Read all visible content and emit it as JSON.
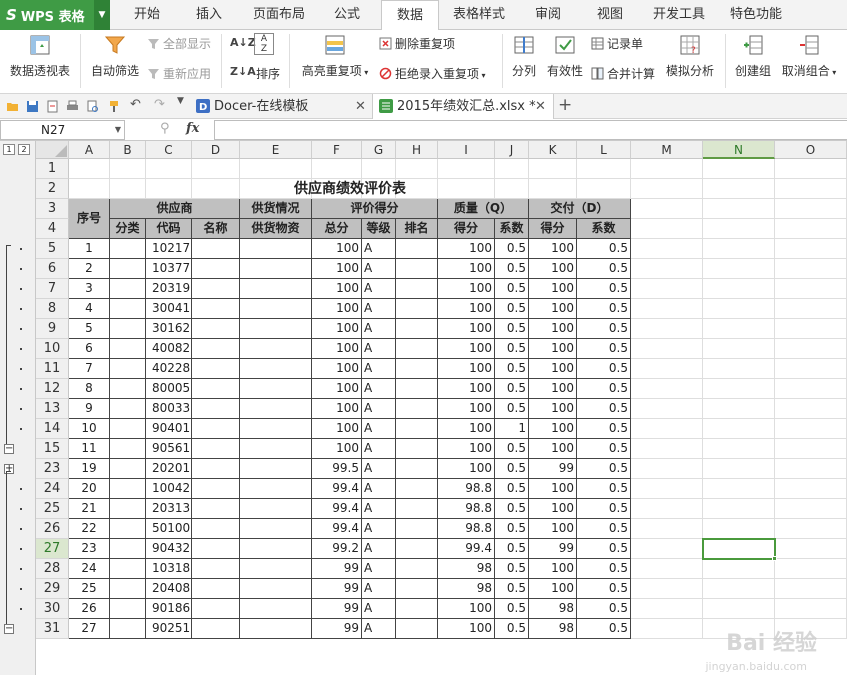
{
  "app": {
    "name": "WPS 表格",
    "logo": "S"
  },
  "menu_tabs": [
    "开始",
    "插入",
    "页面布局",
    "公式",
    "数据",
    "表格样式",
    "审阅",
    "视图",
    "开发工具",
    "特色功能"
  ],
  "menu_active_index": 4,
  "ribbon": {
    "pivot": "数据透视表",
    "autofilter": "自动筛选",
    "show_all": "全部显示",
    "reapply": "重新应用",
    "sort": "排序",
    "highlight_dup": "高亮重复项",
    "remove_dup": "删除重复项",
    "reject_dup": "拒绝录入重复项",
    "split": "分列",
    "validity": "有效性",
    "record_form": "记录单",
    "consolidate": "合并计算",
    "simulate": "模拟分析",
    "create_group": "创建组",
    "ungroup": "取消组合"
  },
  "doc_tabs": [
    {
      "label": "Docer-在线模板"
    },
    {
      "label": "2015年绩效汇总.xlsx *"
    }
  ],
  "formula": {
    "name_box": "N27",
    "fx": "fx",
    "content": ""
  },
  "level_buttons": [
    "1",
    "2"
  ],
  "columns": [
    "A",
    "B",
    "C",
    "D",
    "E",
    "F",
    "G",
    "H",
    "I",
    "J",
    "K",
    "L",
    "M",
    "N",
    "O"
  ],
  "selected_column": "N",
  "selected_row": "27",
  "sheet": {
    "title": "供应商绩效评价表",
    "header_row3": {
      "seq": "序号",
      "supplier": "供应商",
      "supply_info": "供货情况",
      "eval_score": "评价得分",
      "quality": "质量（Q）",
      "delivery": "交付（D）"
    },
    "header_row4": {
      "category": "分类",
      "code": "代码",
      "name": "名称",
      "supply_material": "供货物资",
      "total": "总分",
      "grade": "等级",
      "rank": "排名",
      "q_score": "得分",
      "q_coef": "系数",
      "d_score": "得分",
      "d_coef": "系数"
    },
    "rows": [
      {
        "r": "5",
        "seq": "1",
        "code": "10217",
        "total": "100",
        "grade": "A",
        "qs": "100",
        "qc": "0.5",
        "ds": "100",
        "dc": "0.5"
      },
      {
        "r": "6",
        "seq": "2",
        "code": "10377",
        "total": "100",
        "grade": "A",
        "qs": "100",
        "qc": "0.5",
        "ds": "100",
        "dc": "0.5"
      },
      {
        "r": "7",
        "seq": "3",
        "code": "20319",
        "total": "100",
        "grade": "A",
        "qs": "100",
        "qc": "0.5",
        "ds": "100",
        "dc": "0.5"
      },
      {
        "r": "8",
        "seq": "4",
        "code": "30041",
        "total": "100",
        "grade": "A",
        "qs": "100",
        "qc": "0.5",
        "ds": "100",
        "dc": "0.5"
      },
      {
        "r": "9",
        "seq": "5",
        "code": "30162",
        "total": "100",
        "grade": "A",
        "qs": "100",
        "qc": "0.5",
        "ds": "100",
        "dc": "0.5"
      },
      {
        "r": "10",
        "seq": "6",
        "code": "40082",
        "total": "100",
        "grade": "A",
        "qs": "100",
        "qc": "0.5",
        "ds": "100",
        "dc": "0.5"
      },
      {
        "r": "11",
        "seq": "7",
        "code": "40228",
        "total": "100",
        "grade": "A",
        "qs": "100",
        "qc": "0.5",
        "ds": "100",
        "dc": "0.5"
      },
      {
        "r": "12",
        "seq": "8",
        "code": "80005",
        "total": "100",
        "grade": "A",
        "qs": "100",
        "qc": "0.5",
        "ds": "100",
        "dc": "0.5"
      },
      {
        "r": "13",
        "seq": "9",
        "code": "80033",
        "total": "100",
        "grade": "A",
        "qs": "100",
        "qc": "0.5",
        "ds": "100",
        "dc": "0.5"
      },
      {
        "r": "14",
        "seq": "10",
        "code": "90401",
        "total": "100",
        "grade": "A",
        "qs": "100",
        "qc": "1",
        "ds": "100",
        "dc": "0.5"
      },
      {
        "r": "15",
        "seq": "11",
        "code": "90561",
        "total": "100",
        "grade": "A",
        "qs": "100",
        "qc": "0.5",
        "ds": "100",
        "dc": "0.5"
      },
      {
        "r": "23",
        "seq": "19",
        "code": "20201",
        "total": "99.5",
        "grade": "A",
        "qs": "100",
        "qc": "0.5",
        "ds": "99",
        "dc": "0.5"
      },
      {
        "r": "24",
        "seq": "20",
        "code": "10042",
        "total": "99.4",
        "grade": "A",
        "qs": "98.8",
        "qc": "0.5",
        "ds": "100",
        "dc": "0.5"
      },
      {
        "r": "25",
        "seq": "21",
        "code": "20313",
        "total": "99.4",
        "grade": "A",
        "qs": "98.8",
        "qc": "0.5",
        "ds": "100",
        "dc": "0.5"
      },
      {
        "r": "26",
        "seq": "22",
        "code": "50100",
        "total": "99.4",
        "grade": "A",
        "qs": "98.8",
        "qc": "0.5",
        "ds": "100",
        "dc": "0.5"
      },
      {
        "r": "27",
        "seq": "23",
        "code": "90432",
        "total": "99.2",
        "grade": "A",
        "qs": "99.4",
        "qc": "0.5",
        "ds": "99",
        "dc": "0.5"
      },
      {
        "r": "28",
        "seq": "24",
        "code": "10318",
        "total": "99",
        "grade": "A",
        "qs": "98",
        "qc": "0.5",
        "ds": "100",
        "dc": "0.5"
      },
      {
        "r": "29",
        "seq": "25",
        "code": "20408",
        "total": "99",
        "grade": "A",
        "qs": "98",
        "qc": "0.5",
        "ds": "100",
        "dc": "0.5"
      },
      {
        "r": "30",
        "seq": "26",
        "code": "90186",
        "total": "99",
        "grade": "A",
        "qs": "100",
        "qc": "0.5",
        "ds": "98",
        "dc": "0.5"
      },
      {
        "r": "31",
        "seq": "27",
        "code": "90251",
        "total": "99",
        "grade": "A",
        "qs": "100",
        "qc": "0.5",
        "ds": "98",
        "dc": "0.5"
      }
    ]
  },
  "watermark": {
    "brand": "Bai 经验",
    "url": "jingyan.baidu.com"
  },
  "colors": {
    "accent": "#3f9b45",
    "header_fill": "#c0c0c0",
    "selection": "#4a9a3c"
  }
}
